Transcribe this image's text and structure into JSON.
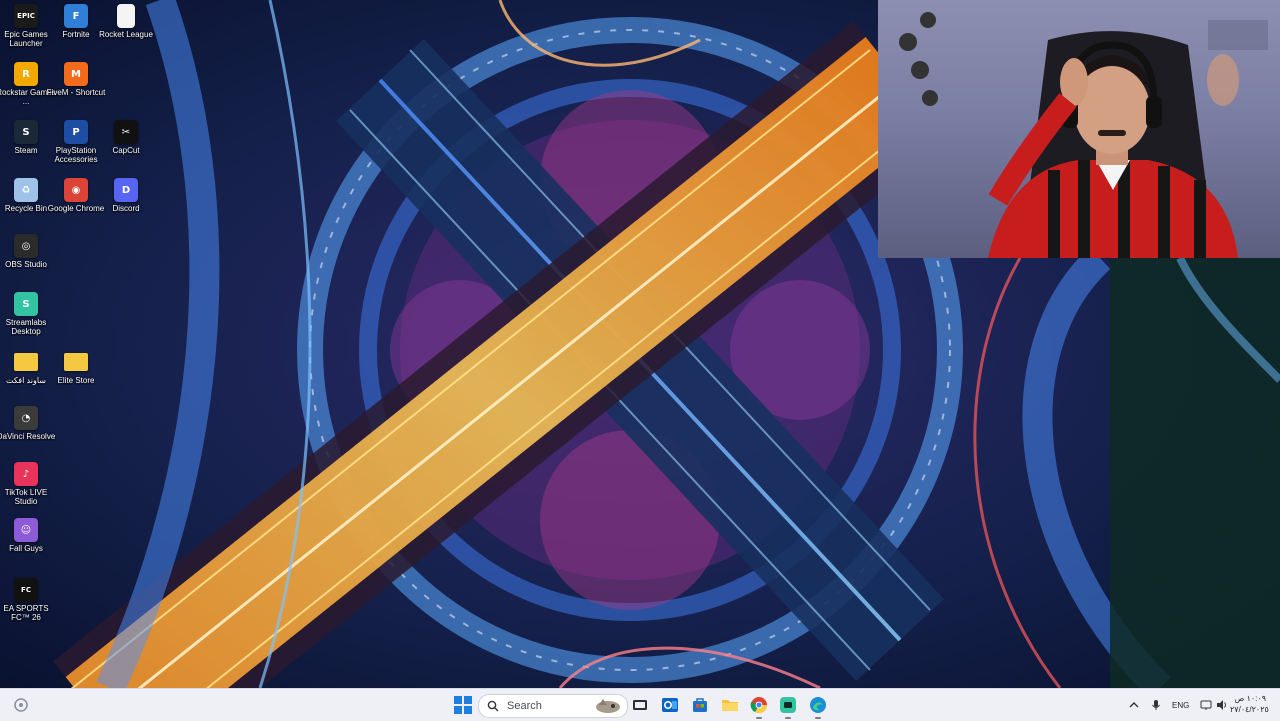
{
  "desktop_icons": [
    {
      "name": "epic-games-launcher",
      "label": "Epic Games Launcher",
      "icon": "epic-icon",
      "color": "#1a1a1a",
      "glyph": "EPIC"
    },
    {
      "name": "fortnite",
      "label": "Fortnite",
      "icon": "fortnite-icon",
      "color": "#2f7fd6",
      "glyph": "F"
    },
    {
      "name": "rocket-league",
      "label": "Rocket League",
      "icon": "file-icon",
      "color": "#f4f4f4",
      "glyph": ""
    },
    {
      "name": "rockstar-games",
      "label": "Rockstar Games ...",
      "icon": "rockstar-icon",
      "color": "#f2a900",
      "glyph": "R"
    },
    {
      "name": "fivem",
      "label": "FiveM - Shortcut",
      "icon": "fivem-icon",
      "color": "#f26b1d",
      "glyph": "M"
    },
    {
      "name": "steam",
      "label": "Steam",
      "icon": "steam-icon",
      "color": "#1b2838",
      "glyph": "S"
    },
    {
      "name": "playstation-accessories",
      "label": "PlayStation Accessories",
      "icon": "playstation-icon",
      "color": "#1d4ea3",
      "glyph": "P"
    },
    {
      "name": "capcut",
      "label": "CapCut",
      "icon": "capcut-icon",
      "color": "#111111",
      "glyph": "✂"
    },
    {
      "name": "recycle-bin",
      "label": "Recycle Bin",
      "icon": "recycle-bin-icon",
      "color": "#9fc3e8",
      "glyph": "♻"
    },
    {
      "name": "google-chrome",
      "label": "Google Chrome",
      "icon": "chrome-icon",
      "color": "#db4437",
      "glyph": "◉"
    },
    {
      "name": "discord",
      "label": "Discord",
      "icon": "discord-icon",
      "color": "#5865f2",
      "glyph": "D"
    },
    {
      "name": "obs-studio",
      "label": "OBS Studio",
      "icon": "obs-icon",
      "color": "#2b2b2b",
      "glyph": "◎"
    },
    {
      "name": "streamlabs-desktop",
      "label": "Streamlabs Desktop",
      "icon": "streamlabs-icon",
      "color": "#31c3a2",
      "glyph": "S"
    },
    {
      "name": "arabic-folder",
      "label": "ساوند افكت",
      "icon": "folder-icon",
      "color": "#f5c842",
      "glyph": ""
    },
    {
      "name": "elite-store",
      "label": "Elite Store",
      "icon": "folder-icon",
      "color": "#f5c842",
      "glyph": ""
    },
    {
      "name": "davinci-resolve",
      "label": "DaVinci Resolve",
      "icon": "davinci-icon",
      "color": "#3b3b3b",
      "glyph": "◔"
    },
    {
      "name": "tiktok-live-studio",
      "label": "TikTok LIVE Studio",
      "icon": "tiktok-icon",
      "color": "#e8335a",
      "glyph": "♪"
    },
    {
      "name": "fall-guys",
      "label": "Fall Guys",
      "icon": "fall-guys-icon",
      "color": "#8d5bd8",
      "glyph": "☺"
    },
    {
      "name": "ea-sports-fc",
      "label": "EA SPORTS FC™ 26",
      "icon": "ea-fc-icon",
      "color": "#111111",
      "glyph": "FC"
    }
  ],
  "taskbar": {
    "search_placeholder": "Search",
    "apps": [
      {
        "name": "task-view",
        "icon": "task-view-icon"
      },
      {
        "name": "outlook",
        "icon": "outlook-icon"
      },
      {
        "name": "microsoft-store",
        "icon": "store-icon"
      },
      {
        "name": "file-explorer",
        "icon": "folder-icon"
      },
      {
        "name": "chrome",
        "icon": "chrome-icon"
      },
      {
        "name": "streamlabs",
        "icon": "streamlabs-icon"
      },
      {
        "name": "edge",
        "icon": "edge-icon"
      }
    ],
    "tray": {
      "language": "ENG",
      "time": "١٠:٠٩ ص",
      "date": "٢٧/٠٤/٢٠٢٥"
    }
  },
  "colors": {
    "taskbar_bg": "#eef0f5",
    "wallpaper_dark": "#0b1430",
    "road_orange": "#f2a23a",
    "road_magenta": "#c04a8f"
  }
}
